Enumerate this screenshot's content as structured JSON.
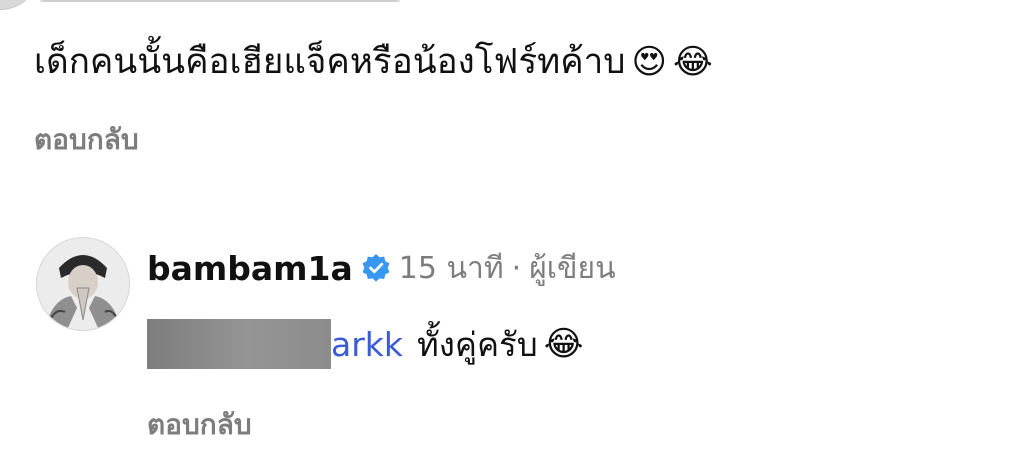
{
  "comment_1": {
    "text": "เด็กคนนั้นคือเฮียแจ็คหรือน้องโฟร์ทค้าบ",
    "emoji_1": "😍",
    "emoji_2": "😂",
    "reply_label": "ตอบกลับ"
  },
  "reply": {
    "username": "bambam1a",
    "verified_icon": "verified-badge-icon",
    "time": "15 นาที",
    "separator": "·",
    "author_label": "ผู้เขียน",
    "mention": "arkk",
    "text": "ทั้งคู่ครับ",
    "emoji": "😂",
    "reply_label": "ตอบกลับ"
  },
  "colors": {
    "verified": "#3897f0",
    "mention": "#3b5bdb",
    "muted": "#7d7d7d",
    "redaction": "#8a8a8a"
  }
}
